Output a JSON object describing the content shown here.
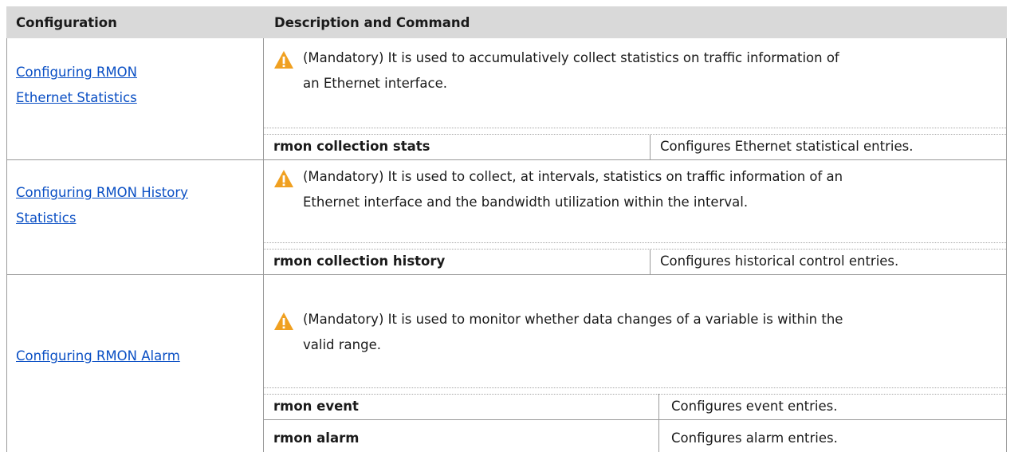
{
  "table": {
    "headers": {
      "configuration": "Configuration",
      "description": "Description and Command"
    },
    "rows": [
      {
        "configuration_link": [
          "Configuring RMON",
          "Ethernet Statistics"
        ],
        "note": [
          "(Mandatory) It is used to accumulatively collect statistics on traffic information of",
          "an Ethernet interface."
        ],
        "commands": [
          {
            "command": "rmon collection stats",
            "description": "Configures Ethernet statistical entries."
          }
        ]
      },
      {
        "configuration_link": [
          "Configuring RMON History",
          "Statistics"
        ],
        "note": [
          "(Mandatory) It is used to collect, at intervals, statistics on traffic information of an",
          "Ethernet interface and the bandwidth utilization within the interval."
        ],
        "commands": [
          {
            "command": "rmon collection history",
            "description": "Configures historical control entries."
          }
        ]
      },
      {
        "configuration_link": [
          "Configuring RMON Alarm"
        ],
        "note": [
          "(Mandatory) It is used to monitor whether data changes of a variable is within the",
          "valid range."
        ],
        "commands": [
          {
            "command": "rmon event",
            "description": "Configures event entries."
          },
          {
            "command": "rmon alarm",
            "description": "Configures alarm entries."
          }
        ]
      }
    ]
  },
  "icons": {
    "note_icon": "warning-triangle-icon",
    "note_icon_color": "#f0a020"
  }
}
